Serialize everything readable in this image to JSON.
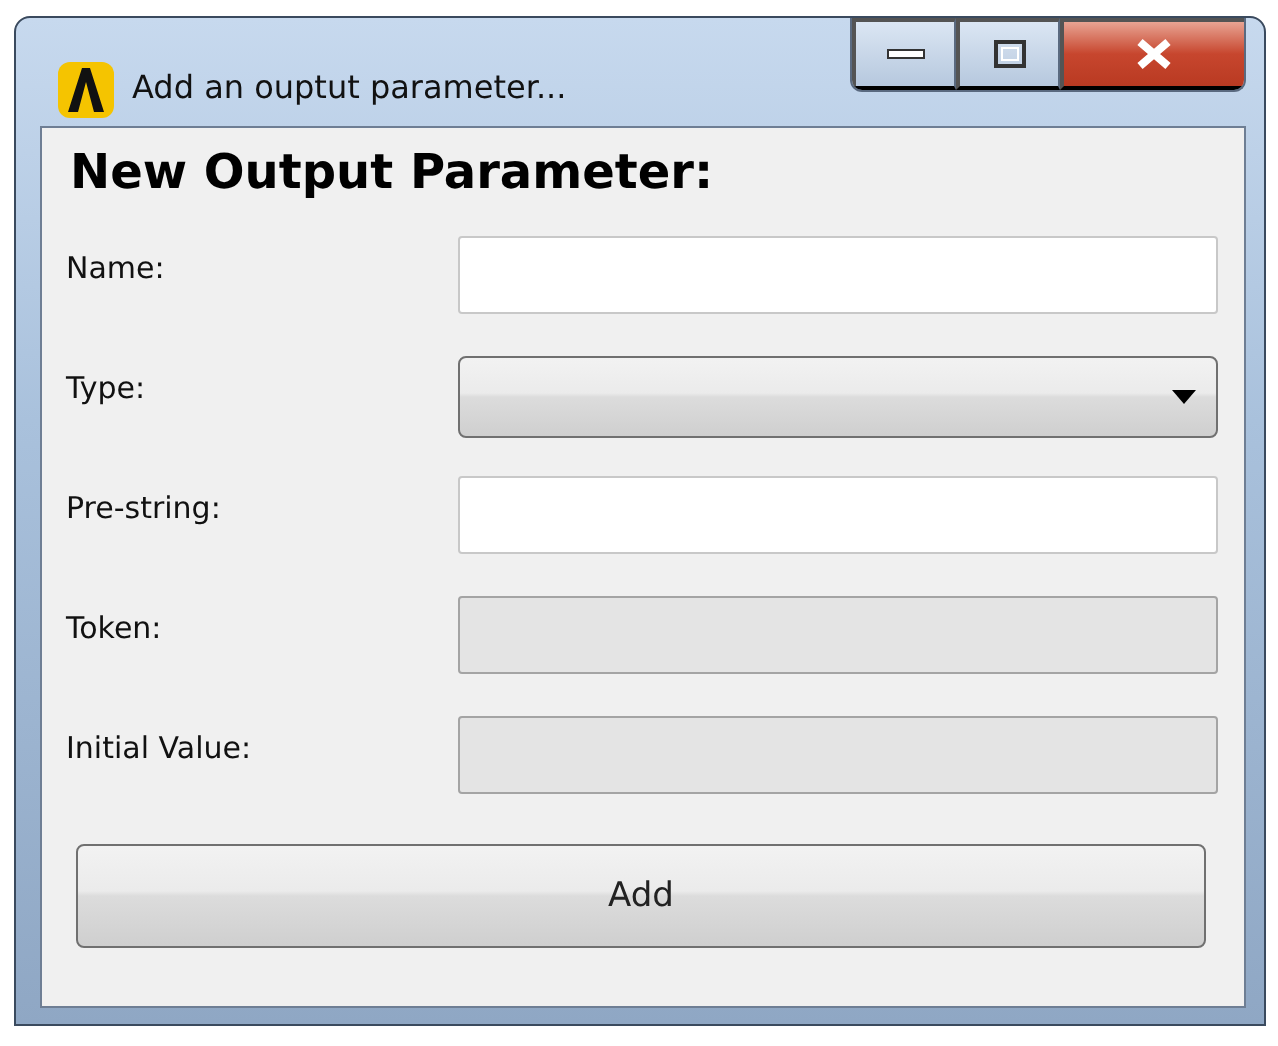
{
  "window": {
    "title": "Add an ouptut parameter..."
  },
  "heading": "New Output Parameter:",
  "fields": [
    {
      "label": "Name:",
      "kind": "text",
      "disabled": false
    },
    {
      "label": "Type:",
      "kind": "combo",
      "disabled": false
    },
    {
      "label": "Pre-string:",
      "kind": "text",
      "disabled": false
    },
    {
      "label": "Token:",
      "kind": "text",
      "disabled": true
    },
    {
      "label": "Initial Value:",
      "kind": "text",
      "disabled": true
    }
  ],
  "button": "Add"
}
